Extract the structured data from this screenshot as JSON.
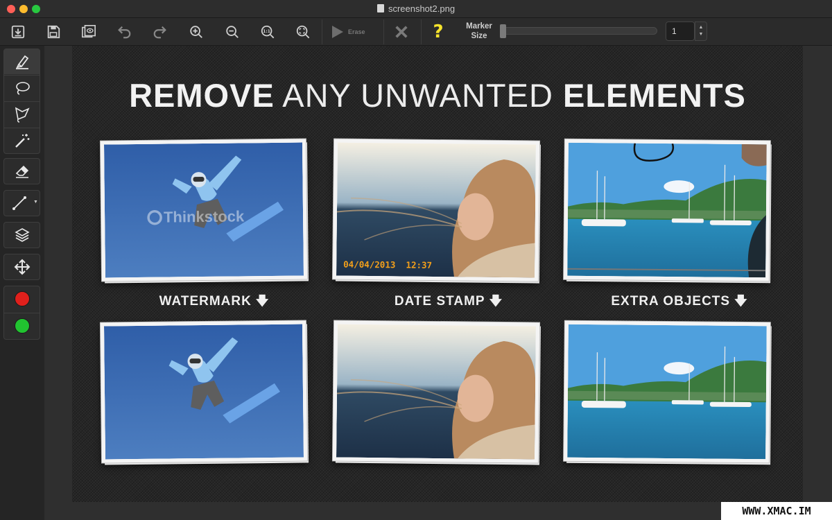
{
  "window": {
    "title": "screenshot2.png"
  },
  "toolbar": {
    "erase_label": "Erase",
    "help_label": "?",
    "marker_size_line1": "Marker",
    "marker_size_line2": "Size",
    "marker_size_value": "1",
    "marker_size_level": 0.0,
    "buttons": [
      "open-icon",
      "save-icon",
      "save-as-icon",
      "undo-icon",
      "redo-icon",
      "zoom-in-icon",
      "zoom-out-icon",
      "actual-size-icon",
      "zoom-fit-icon",
      "play-icon",
      "cancel-icon"
    ]
  },
  "tools": {
    "items": [
      "marker-icon",
      "lasso-icon",
      "polygon-lasso-icon",
      "magic-wand-icon",
      "eraser-icon",
      "line-icon",
      "layers-icon",
      "move-icon"
    ],
    "colors": {
      "red": "#e0201c",
      "green": "#21c330"
    }
  },
  "canvas": {
    "headline_bold_1": "REMOVE",
    "headline_light": "ANY UNWANTED",
    "headline_bold_2": "ELEMENTS",
    "captions": [
      "WATERMARK",
      "DATE STAMP",
      "EXTRA OBJECTS"
    ],
    "arrow": "🡇",
    "watermark_text": "Thinkstock",
    "date_stamp": "04/04/2013  12:37"
  },
  "site_watermark": "WWW.XMAC.IM"
}
